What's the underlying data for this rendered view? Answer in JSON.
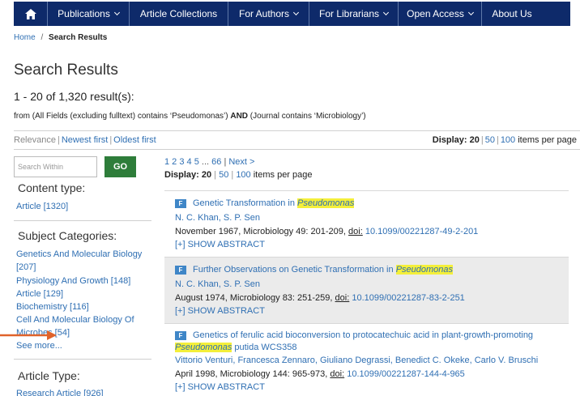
{
  "nav": {
    "home_icon": "home-icon",
    "items": [
      {
        "label": "Publications",
        "has_dropdown": true
      },
      {
        "label": "Article Collections",
        "has_dropdown": false
      },
      {
        "label": "For Authors",
        "has_dropdown": true
      },
      {
        "label": "For Librarians",
        "has_dropdown": true
      },
      {
        "label": "Open Access",
        "has_dropdown": true
      },
      {
        "label": "About Us",
        "has_dropdown": false
      }
    ],
    "background": "#0e2a6a"
  },
  "breadcrumb": {
    "home": "Home",
    "separator": "/",
    "current": "Search Results"
  },
  "page_title": "Search Results",
  "result_count": "1 - 20 of 1,320 result(s):",
  "query": {
    "part1": "from (All Fields (excluding fulltext) contains ‘Pseudomonas’)",
    "operator": "AND",
    "part2": "(Journal contains ‘Microbiology’)"
  },
  "sort": {
    "options": [
      "Relevance",
      "Newest first",
      "Oldest first"
    ],
    "display_label": "Display: 20",
    "display_options": [
      "50",
      "100"
    ],
    "display_suffix": "items per page"
  },
  "search_within": {
    "placeholder": "Search Within",
    "button": "GO",
    "button_color": "#2e7d3a"
  },
  "facets": {
    "content_type": {
      "heading": "Content type:",
      "items": [
        "Article [1320]"
      ]
    },
    "subject_categories": {
      "heading": "Subject Categories:",
      "items": [
        "Genetics And Molecular Biology",
        "[207]",
        "Physiology And Growth [148]",
        "Article [129]",
        "Biochemistry [116]",
        "Cell And Molecular Biology Of",
        "Microbes [54]"
      ],
      "see_more": "See more..."
    },
    "article_type": {
      "heading": "Article Type:",
      "items": [
        "Research Article [926]"
      ]
    }
  },
  "pager": {
    "pages": "1 2 3 4 5",
    "ellipsis": "...",
    "last": "66",
    "separator": "|",
    "next": "Next >"
  },
  "display_small": {
    "label": "Display: 20",
    "options": [
      "50",
      "100"
    ],
    "suffix": "items per page"
  },
  "results": [
    {
      "badge": "F",
      "title_prefix": "Genetic Transformation in",
      "title_highlight": "Pseudomonas",
      "title_suffix": "",
      "title_line2_highlight": "",
      "title_line2": "",
      "authors": "N. C. Khan, S. P. Sen",
      "citation": "November 1967, Microbiology 49: 201-209,",
      "doi_label": "doi:",
      "doi": "10.1099/00221287-49-2-201",
      "show_abstract": "[+] SHOW ABSTRACT"
    },
    {
      "badge": "F",
      "title_prefix": "Further Observations on Genetic Transformation in",
      "title_highlight": "Pseudomonas",
      "title_suffix": "",
      "title_line2_highlight": "",
      "title_line2": "",
      "authors": "N. C. Khan, S. P. Sen",
      "citation": "August 1974, Microbiology 83: 251-259,",
      "doi_label": "doi:",
      "doi": "10.1099/00221287-83-2-251",
      "show_abstract": "[+] SHOW ABSTRACT"
    },
    {
      "badge": "F",
      "title_prefix": "Genetics of ferulic acid bioconversion to protocatechuic acid in plant-growth-promoting",
      "title_highlight": "",
      "title_suffix": "",
      "title_line2_highlight": "Pseudomonas",
      "title_line2": "putida WCS358",
      "authors": "Vittorio Venturi, Francesca Zennaro, Giuliano Degrassi, Benedict C. Okeke, Carlo V. Bruschi",
      "citation": "April 1998, Microbiology 144: 965-973,",
      "doi_label": "doi:",
      "doi": "10.1099/00221287-144-4-965",
      "show_abstract": "[+] SHOW ABSTRACT"
    }
  ],
  "colors": {
    "link": "#2f6fb3",
    "highlight": "#f4ef3a",
    "badge": "#3f86c7",
    "annotation_arrow": "#e0632a"
  }
}
